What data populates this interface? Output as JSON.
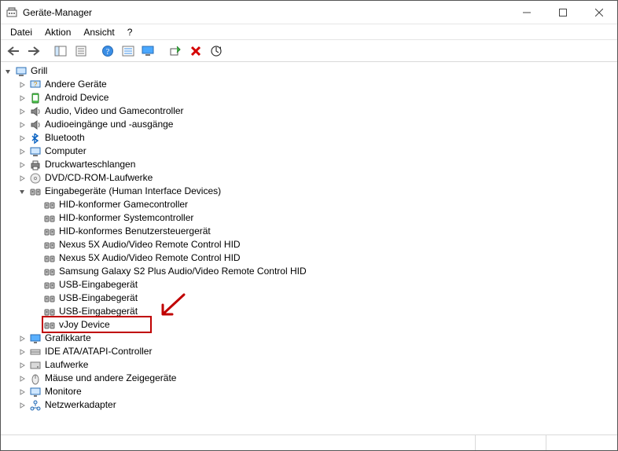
{
  "window": {
    "title": "Geräte-Manager"
  },
  "menu": {
    "file": "Datei",
    "action": "Aktion",
    "view": "Ansicht",
    "help": "?"
  },
  "toolbar": {
    "back": "back",
    "forward": "forward",
    "show_hide": "show-hide-tree",
    "properties": "properties",
    "help": "help",
    "list": "list",
    "monitor": "update-display",
    "scan": "scan-hardware",
    "remove": "remove-device",
    "update": "update-driver"
  },
  "tree": {
    "root": {
      "label": "Grill",
      "expanded": true
    },
    "children": [
      {
        "label": "Andere Geräte",
        "icon": "unknown",
        "expandable": true
      },
      {
        "label": "Android Device",
        "icon": "android",
        "expandable": true
      },
      {
        "label": "Audio, Video und Gamecontroller",
        "icon": "audio",
        "expandable": true
      },
      {
        "label": "Audioeingänge und -ausgänge",
        "icon": "audio",
        "expandable": true
      },
      {
        "label": "Bluetooth",
        "icon": "bluetooth",
        "expandable": true
      },
      {
        "label": "Computer",
        "icon": "computer",
        "expandable": true
      },
      {
        "label": "Druckwarteschlangen",
        "icon": "printer",
        "expandable": true
      },
      {
        "label": "DVD/CD-ROM-Laufwerke",
        "icon": "disc",
        "expandable": true
      },
      {
        "label": "Eingabegeräte (Human Interface Devices)",
        "icon": "hid",
        "expandable": true,
        "expanded": true,
        "children": [
          {
            "label": "HID-konformer Gamecontroller",
            "icon": "hid"
          },
          {
            "label": "HID-konformer Systemcontroller",
            "icon": "hid"
          },
          {
            "label": "HID-konformes Benutzersteuergerät",
            "icon": "hid"
          },
          {
            "label": "Nexus 5X Audio/Video Remote Control HID",
            "icon": "hid"
          },
          {
            "label": "Nexus 5X Audio/Video Remote Control HID",
            "icon": "hid"
          },
          {
            "label": "Samsung Galaxy S2 Plus Audio/Video Remote Control HID",
            "icon": "hid"
          },
          {
            "label": "USB-Eingabegerät",
            "icon": "hid"
          },
          {
            "label": "USB-Eingabegerät",
            "icon": "hid"
          },
          {
            "label": "USB-Eingabegerät",
            "icon": "hid"
          },
          {
            "label": "vJoy Device",
            "icon": "hid",
            "highlighted": true
          }
        ]
      },
      {
        "label": "Grafikkarte",
        "icon": "display",
        "expandable": true
      },
      {
        "label": "IDE ATA/ATAPI-Controller",
        "icon": "ide",
        "expandable": true
      },
      {
        "label": "Laufwerke",
        "icon": "drive",
        "expandable": true
      },
      {
        "label": "Mäuse und andere Zeigegeräte",
        "icon": "mouse",
        "expandable": true
      },
      {
        "label": "Monitore",
        "icon": "monitor",
        "expandable": true
      },
      {
        "label": "Netzwerkadapter",
        "icon": "network",
        "expandable": true
      }
    ]
  }
}
